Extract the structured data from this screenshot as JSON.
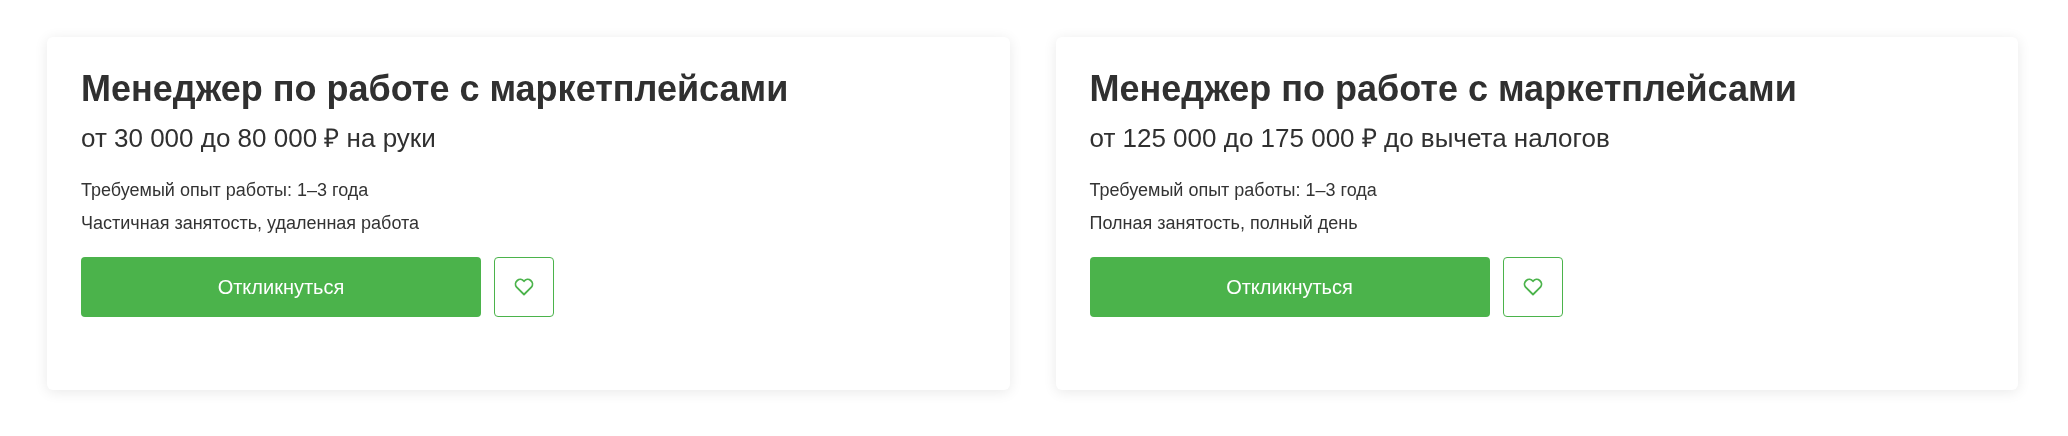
{
  "vacancies": [
    {
      "title": "Менеджер по работе с маркетплейсами",
      "salary": "от 30 000 до 80 000 ₽ на руки",
      "experience": "Требуемый опыт работы: 1–3 года",
      "employment": "Частичная занятость, удаленная работа",
      "apply_button": "Откликнуться",
      "favorite": false
    },
    {
      "title": "Менеджер по работе с маркетплейсами",
      "salary": "от 125 000 до 175 000 ₽ до вычета налогов",
      "experience": "Требуемый опыт работы: 1–3 года",
      "employment": "Полная занятость, полный день",
      "apply_button": "Откликнуться",
      "favorite": false
    }
  ]
}
